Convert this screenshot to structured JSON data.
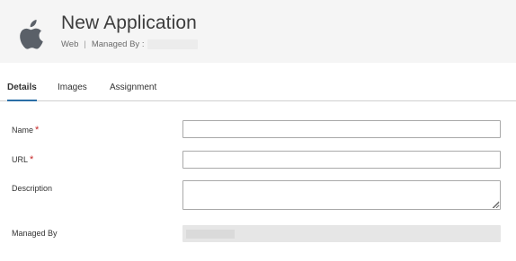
{
  "header": {
    "title": "New Application",
    "type": "Web",
    "separator": "|",
    "managed_by_label": "Managed By :",
    "icon": "apple-logo-icon"
  },
  "tabs": [
    {
      "label": "Details",
      "active": true
    },
    {
      "label": "Images",
      "active": false
    },
    {
      "label": "Assignment",
      "active": false
    }
  ],
  "form": {
    "name_label": "Name",
    "url_label": "URL",
    "description_label": "Description",
    "managed_by_label": "Managed By",
    "required_mark": "*",
    "name_value": "",
    "url_value": "",
    "description_value": ""
  },
  "colors": {
    "header_bg": "#f5f5f5",
    "active_tab_underline": "#2a6ea6",
    "required": "#c62828"
  }
}
